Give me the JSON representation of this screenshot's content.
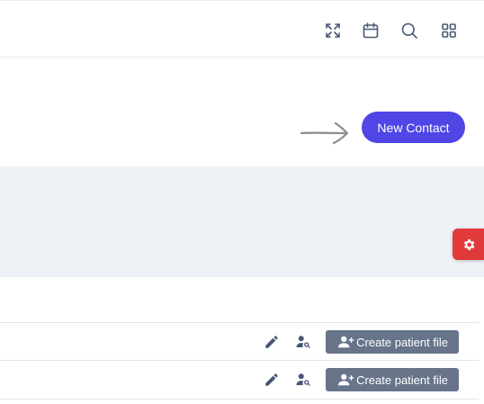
{
  "topbar": {
    "icons": [
      "fullscreen-icon",
      "calendar-icon",
      "search-icon",
      "apps-grid-icon"
    ]
  },
  "actions": {
    "new_contact_label": "New Contact",
    "primary_color": "#4f46e5"
  },
  "settings": {
    "icon": "gear-icon",
    "color": "#e03a3a"
  },
  "table": {
    "rows": [
      {
        "create_label": "Create patient file"
      },
      {
        "create_label": "Create patient file"
      }
    ]
  },
  "colors": {
    "button_gray": "#67748a",
    "icon": "#495774",
    "band": "#eef1f6"
  }
}
